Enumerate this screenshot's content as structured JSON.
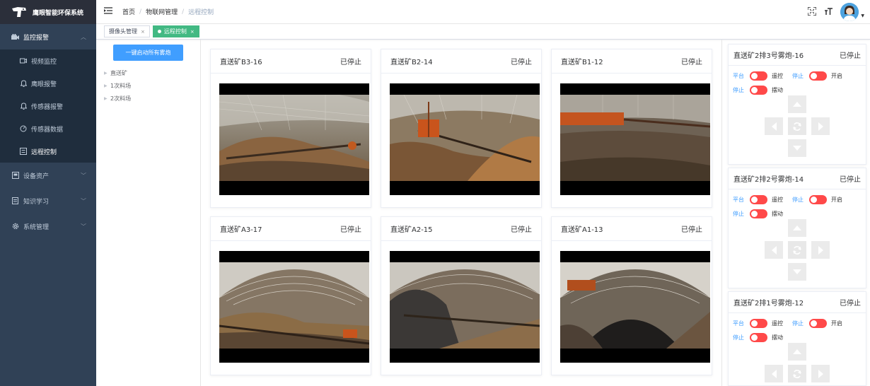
{
  "app": {
    "title": "鹰眼智能环保系统"
  },
  "sidebar": {
    "groups": [
      {
        "label": "监控报警",
        "icon": "camera-icon",
        "items": [
          {
            "label": "视频监控",
            "icon": "video-icon"
          },
          {
            "label": "鹰眼报警",
            "icon": "bell-icon"
          },
          {
            "label": "传感器报警",
            "icon": "bell-icon"
          },
          {
            "label": "传感器数据",
            "icon": "gauge-icon"
          },
          {
            "label": "远程控制",
            "icon": "remote-icon"
          }
        ]
      },
      {
        "label": "设备资产",
        "icon": "asset-icon"
      },
      {
        "label": "知识学习",
        "icon": "document-icon"
      },
      {
        "label": "系统管理",
        "icon": "gear-icon"
      }
    ]
  },
  "breadcrumb": [
    "首页",
    "物联网管理",
    "远程控制"
  ],
  "tags": [
    {
      "label": "摄像头管理",
      "active": false
    },
    {
      "label": "远程控制",
      "active": true
    }
  ],
  "tree": {
    "button": "一键启动所有雾炮",
    "nodes": [
      "直送矿",
      "1次料场",
      "2次料场"
    ]
  },
  "cameras": [
    {
      "name": "直送矿B3-16",
      "status": "已停止"
    },
    {
      "name": "直送矿B2-14",
      "status": "已停止"
    },
    {
      "name": "直送矿B1-12",
      "status": "已停止"
    },
    {
      "name": "直送矿A3-17",
      "status": "已停止"
    },
    {
      "name": "直送矿A2-15",
      "status": "已停止"
    },
    {
      "name": "直送矿A1-13",
      "status": "已停止"
    }
  ],
  "controls": [
    {
      "name": "直送矿2排3号雾炮-16",
      "status": "已停止",
      "switches": {
        "platform": "平台",
        "remote": "遥控",
        "stop1": "停止",
        "open": "开启",
        "stop2": "停止",
        "swing": "摆动"
      }
    },
    {
      "name": "直送矿2排2号雾炮-14",
      "status": "已停止",
      "switches": {
        "platform": "平台",
        "remote": "遥控",
        "stop1": "停止",
        "open": "开启",
        "stop2": "停止",
        "swing": "摆动"
      }
    },
    {
      "name": "直送矿2排1号雾炮-12",
      "status": "已停止",
      "switches": {
        "platform": "平台",
        "remote": "遥控",
        "stop1": "停止",
        "open": "开启",
        "stop2": "停止",
        "swing": "摆动"
      }
    }
  ],
  "colors": {
    "sidebar": "#304156",
    "primary": "#409eff",
    "switch_off": "#ff4949",
    "tag_active": "#42b983"
  }
}
